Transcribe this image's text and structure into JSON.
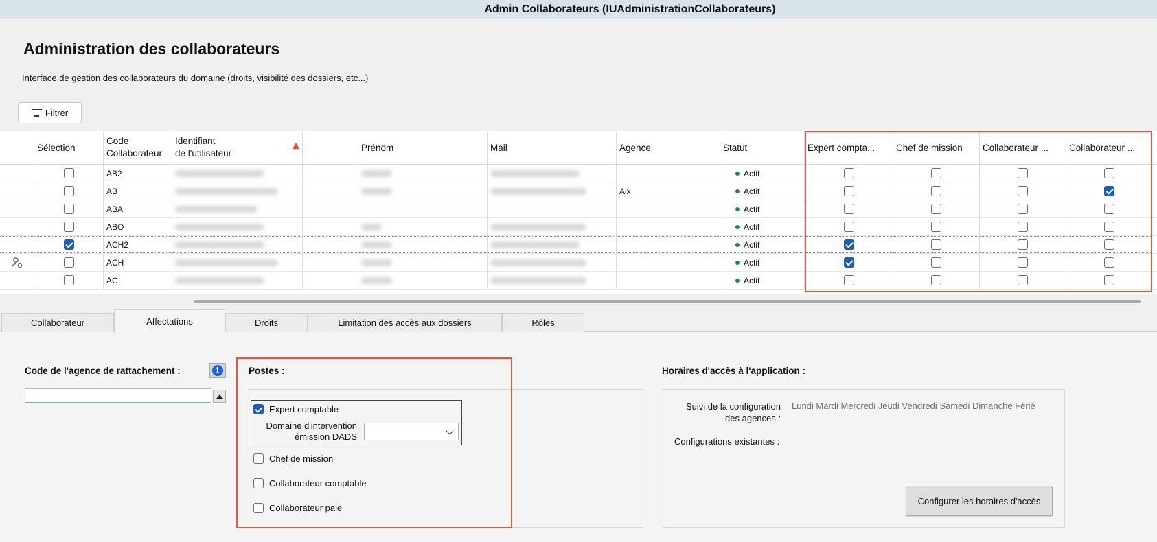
{
  "window": {
    "title": "Admin Collaborateurs (IUAdministrationCollaborateurs)"
  },
  "page": {
    "title": "Administration des collaborateurs",
    "subtitle": "Interface de gestion des collaborateurs du domaine (droits, visibilité des dossiers, etc...)"
  },
  "toolbar": {
    "filter_label": "Filtrer"
  },
  "grid": {
    "columns": {
      "selection": "Sélection",
      "code_l1": "Code",
      "code_l2": "Collaborateur",
      "ident_l1": "Identifiant",
      "ident_l2": "de l'utilisateur",
      "prenom": "Prénom",
      "mail": "Mail",
      "agence": "Agence",
      "statut": "Statut",
      "expert": "Expert compta...",
      "chef": "Chef de mission",
      "collab1": "Collaborateur ...",
      "collab2": "Collaborateur ..."
    },
    "rows": [
      {
        "code": "AB2",
        "agence": "",
        "statut": "Actif",
        "selected": false,
        "expert": false,
        "chef": false,
        "collab1": false,
        "collab2": false
      },
      {
        "code": "AB",
        "agence": "Aix",
        "statut": "Actif",
        "selected": false,
        "expert": false,
        "chef": false,
        "collab1": false,
        "collab2": true
      },
      {
        "code": "ABA",
        "agence": "",
        "statut": "Actif",
        "selected": false,
        "expert": false,
        "chef": false,
        "collab1": false,
        "collab2": false
      },
      {
        "code": "ABO",
        "agence": "",
        "statut": "Actif",
        "selected": false,
        "expert": false,
        "chef": false,
        "collab1": false,
        "collab2": false
      },
      {
        "code": "ACH2",
        "agence": "",
        "statut": "Actif",
        "selected": true,
        "expert": true,
        "chef": false,
        "collab1": false,
        "collab2": false
      },
      {
        "code": "ACH",
        "agence": "",
        "statut": "Actif",
        "selected": false,
        "expert": true,
        "chef": false,
        "collab1": false,
        "collab2": false
      },
      {
        "code": "AC",
        "agence": "",
        "statut": "Actif",
        "selected": false,
        "expert": false,
        "chef": false,
        "collab1": false,
        "collab2": false
      }
    ]
  },
  "tabs": [
    {
      "label": "Collaborateur",
      "active": false
    },
    {
      "label": "Affectations",
      "active": true
    },
    {
      "label": "Droits",
      "active": false
    },
    {
      "label": "Limitation des accès aux dossiers",
      "active": false
    },
    {
      "label": "Rôles",
      "active": false
    }
  ],
  "affectations": {
    "agency_label": "Code de l'agence de rattachement :",
    "agency_value": "",
    "postes_label": "Postes :",
    "postes": {
      "expert": {
        "label": "Expert comptable",
        "checked": true
      },
      "domaine_l1": "Domaine d'intervention",
      "domaine_l2": "émission DADS",
      "domaine_value": "",
      "chef": {
        "label": "Chef de mission",
        "checked": false
      },
      "collab_comptable": {
        "label": "Collaborateur comptable",
        "checked": false
      },
      "collab_paie": {
        "label": "Collaborateur paie",
        "checked": false
      }
    },
    "horaires_label": "Horaires d'accès à l'application :",
    "suivi_l1": "Suivi de la configuration",
    "suivi_l2": "des agences :",
    "days": "Lundi Mardi Mercredi Jeudi Vendredi Samedi Dimanche Férié",
    "config_existantes": "Configurations existantes :",
    "config_button": "Configurer les horaires d'accès"
  },
  "colors": {
    "accent": "#1a5fb4",
    "highlight": "#e2583b",
    "status_active": "#1f8a3a"
  }
}
